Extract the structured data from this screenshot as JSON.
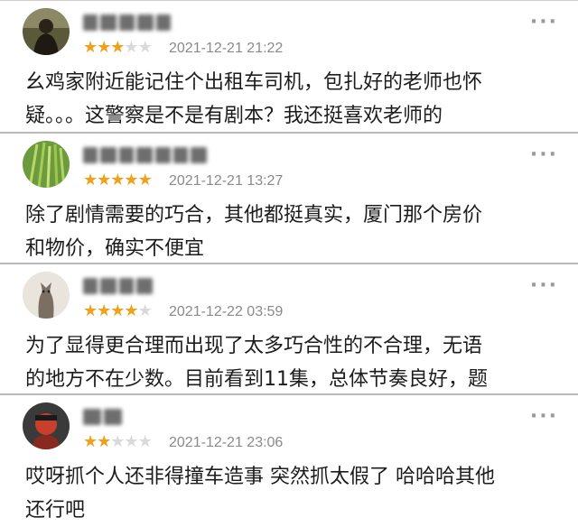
{
  "comments": [
    {
      "avatar": "avatar-dark-figure",
      "rating": 3,
      "rating_max": 5,
      "time": "2021-12-21 21:22",
      "text": "幺鸡家附近能记住个出租车司机，包扎好的老师也怀\n疑。。。这警察是不是有剧本？我还挺喜欢老师的"
    },
    {
      "avatar": "avatar-green-plants",
      "rating": 5,
      "rating_max": 5,
      "time": "2021-12-21 13:27",
      "text": "除了剧情需要的巧合，其他都挺真实，厦门那个房价\n和物价，确实不便宜"
    },
    {
      "avatar": "avatar-cat",
      "rating": 4,
      "rating_max": 5,
      "time": "2021-12-22 03:59",
      "text": "为了显得更合理而出现了太多巧合性的不合理，无语\n的地方不在少数。目前看到11集，总体节奏良好，题"
    },
    {
      "avatar": "avatar-red-portrait",
      "rating": 2,
      "rating_max": 5,
      "time": "2021-12-21 23:06",
      "text": "哎呀抓个人还非得撞车造事 突然抓太假了 哈哈哈其他\n还行吧"
    }
  ],
  "more_icon": "more-dots-icon",
  "colors": {
    "star_on": "#f0a019",
    "star_off": "#d9d9d9",
    "timestamp": "#8a8a8a",
    "divider": "#b9b9b9"
  }
}
